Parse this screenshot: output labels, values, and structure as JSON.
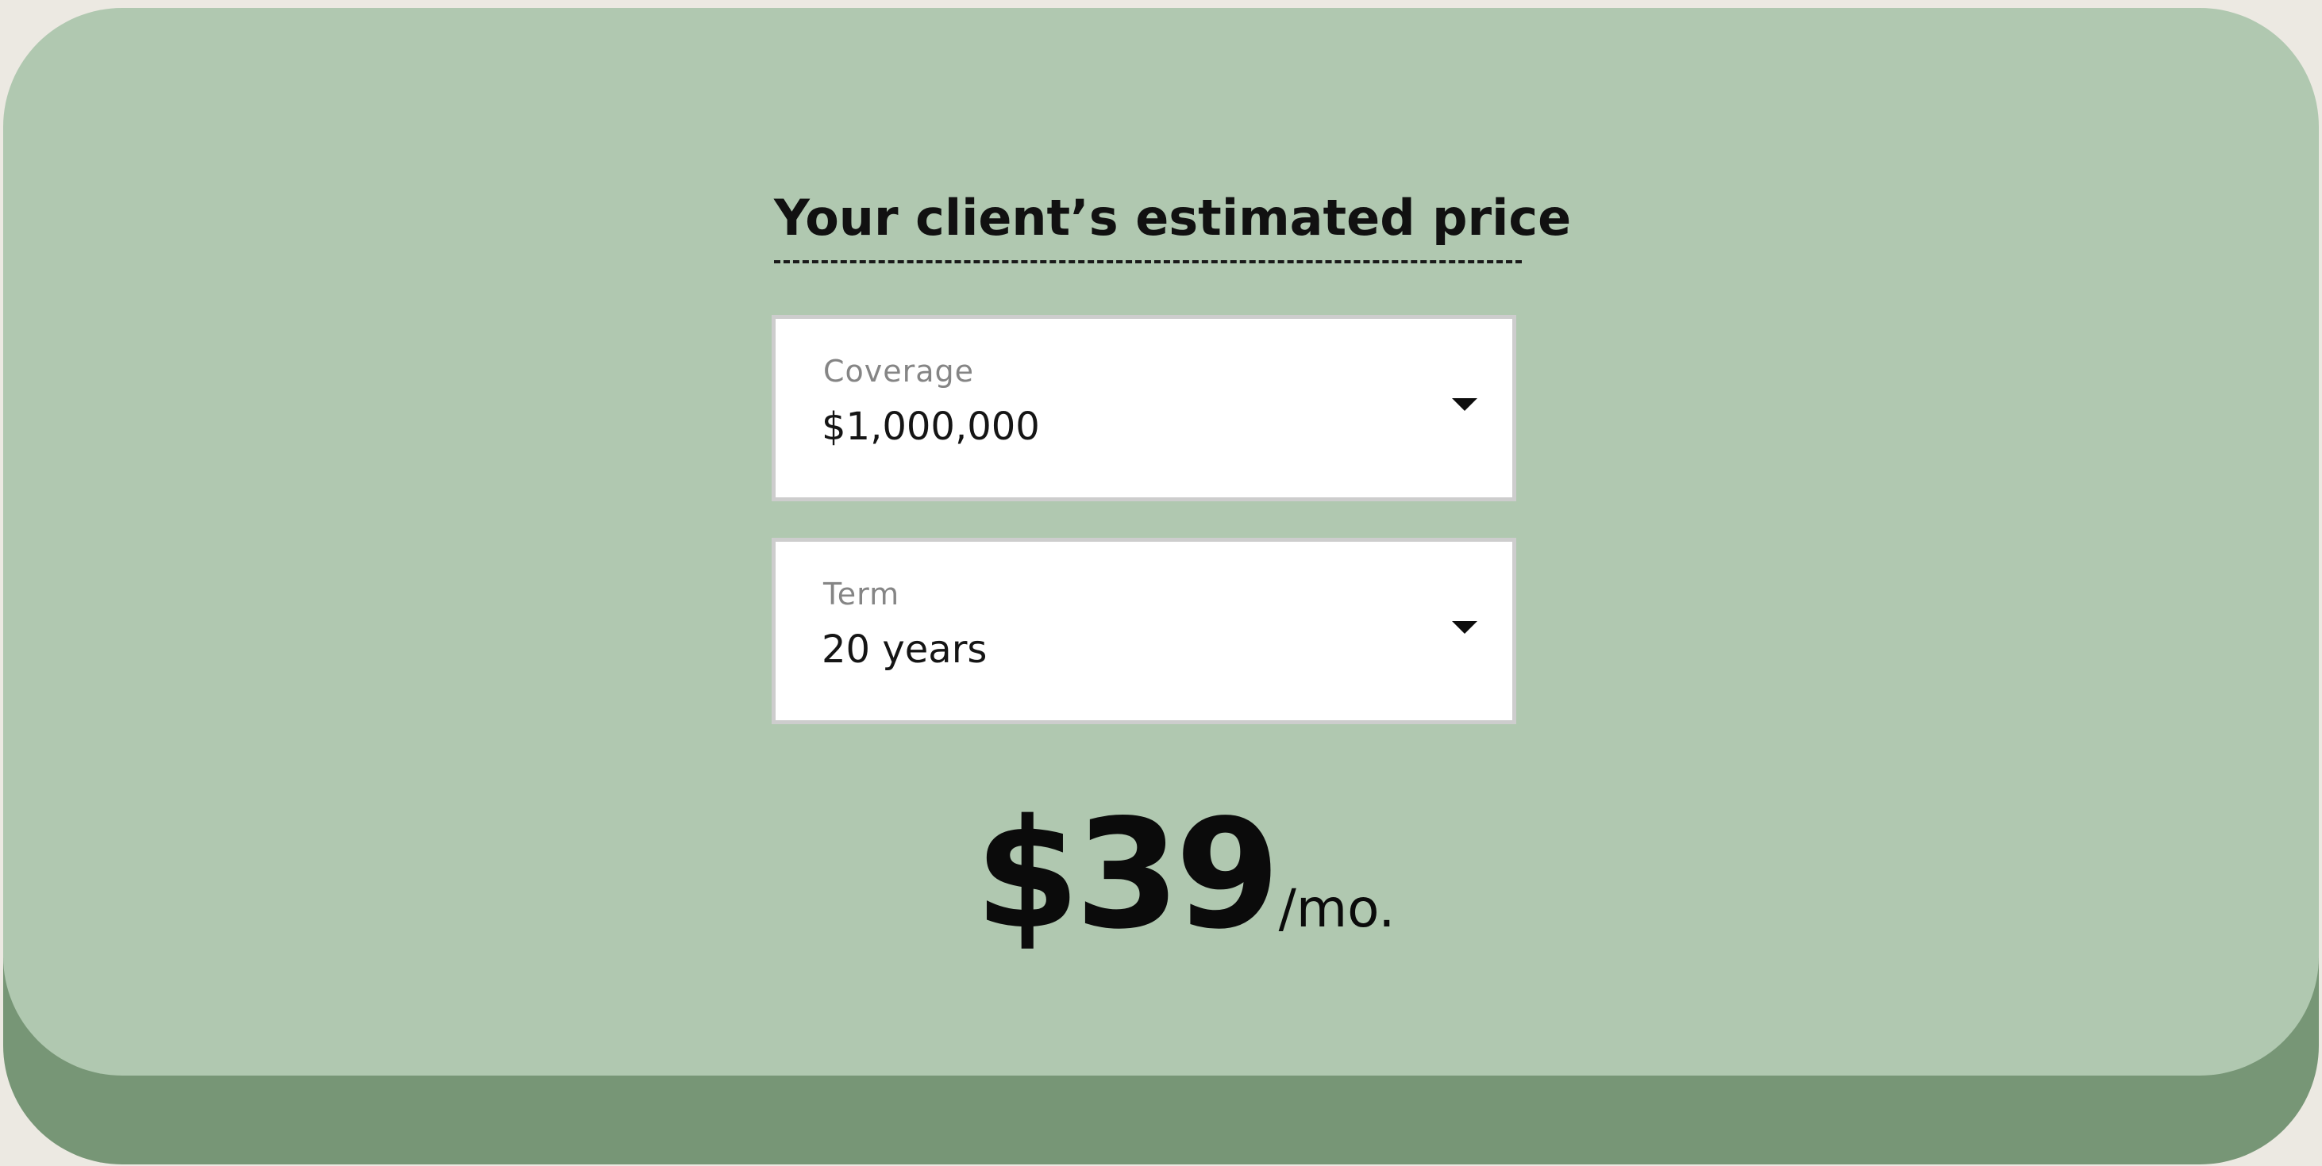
{
  "estimator": {
    "title": "Your client’s estimated price",
    "coverage": {
      "label": "Coverage",
      "value": "$1,000,000"
    },
    "term": {
      "label": "Term",
      "value": "20 years"
    },
    "price": {
      "amount": "$39",
      "unit": "/mo."
    }
  },
  "icons": {
    "dropdown": "chevron-down-icon"
  },
  "colors": {
    "page_background": "#ece9e2",
    "card": "#b0c8b0",
    "card_shadow": "#779676",
    "field_background": "#ffffff",
    "field_border": "#cdcdcd",
    "label_text": "#858585",
    "text": "#111111"
  }
}
